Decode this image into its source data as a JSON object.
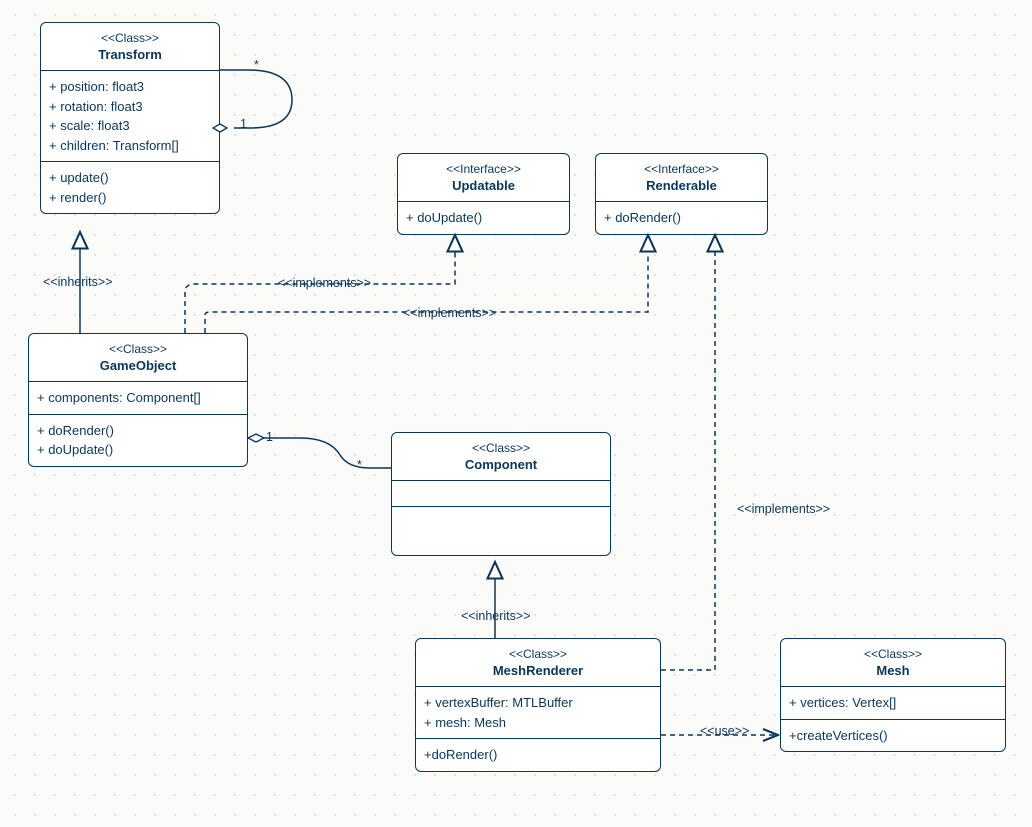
{
  "colors": {
    "stroke": "#0a3659",
    "bg": "#fbfbfa",
    "box": "#ffffff"
  },
  "boxes": {
    "transform": {
      "stereo": "<<Class>>",
      "name": "Transform",
      "attrs": [
        "+ position: float3",
        "+ rotation: float3",
        "+ scale: float3",
        "+ children: Transform[]"
      ],
      "ops": [
        "+ update()",
        "+ render()"
      ]
    },
    "updatable": {
      "stereo": "<<Interface>>",
      "name": "Updatable",
      "ops": [
        "+ doUpdate()"
      ]
    },
    "renderable": {
      "stereo": "<<Interface>>",
      "name": "Renderable",
      "ops": [
        "+ doRender()"
      ]
    },
    "gameobject": {
      "stereo": "<<Class>>",
      "name": "GameObject",
      "attrs": [
        "+ components: Component[]"
      ],
      "ops": [
        "+ doRender()",
        "+ doUpdate()"
      ]
    },
    "component": {
      "stereo": "<<Class>>",
      "name": "Component"
    },
    "meshrenderer": {
      "stereo": "<<Class>>",
      "name": "MeshRenderer",
      "attrs": [
        "+ vertexBuffer: MTLBuffer",
        "+ mesh: Mesh"
      ],
      "ops": [
        "+doRender()"
      ]
    },
    "mesh": {
      "stereo": "<<Class>>",
      "name": "Mesh",
      "attrs": [
        "+ vertices: Vertex[]"
      ],
      "ops": [
        "+createVertices()"
      ]
    }
  },
  "labels": {
    "inherits1": "<<inherits>>",
    "implements1": "<<implements>>",
    "implements2": "<<implements>>",
    "inherits2": "<<inherits>>",
    "implements3": "<<implements>>",
    "use": "<<use>>"
  },
  "cardinals": {
    "star1": "*",
    "one1": "1",
    "one2": "1",
    "star2": "*"
  }
}
